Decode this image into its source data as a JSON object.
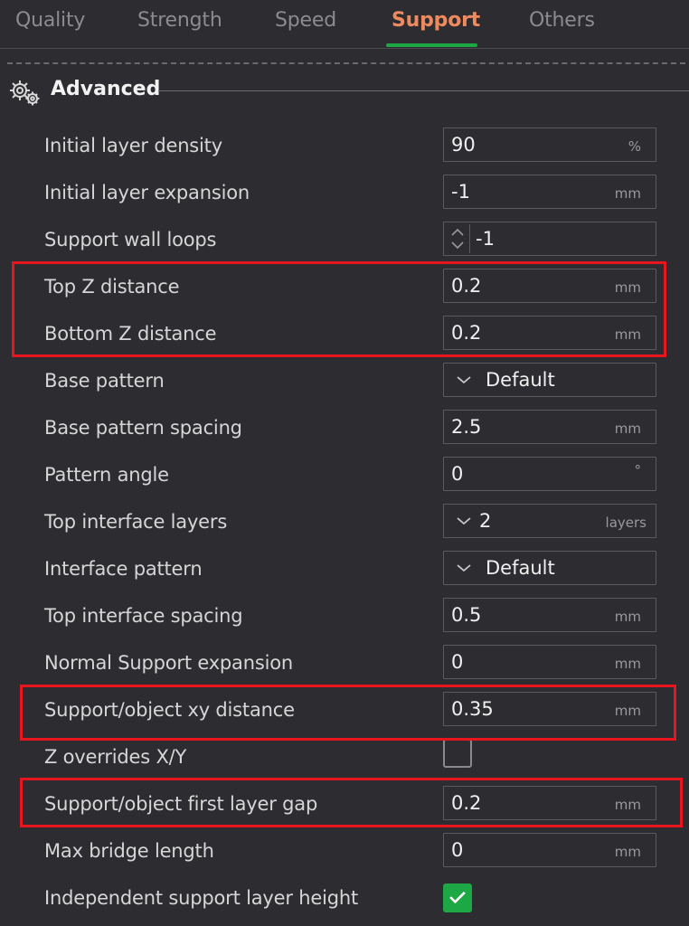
{
  "tabs": [
    {
      "label": "Quality",
      "active": false
    },
    {
      "label": "Strength",
      "active": false
    },
    {
      "label": "Speed",
      "active": false
    },
    {
      "label": "Support",
      "active": true
    },
    {
      "label": "Others",
      "active": false
    }
  ],
  "section": {
    "title": "Advanced",
    "icon": "gears-icon"
  },
  "rows": [
    {
      "label": "Initial layer density",
      "type": "text",
      "value": "90",
      "unit": "%"
    },
    {
      "label": "Initial layer expansion",
      "type": "text",
      "value": "-1",
      "unit": "mm"
    },
    {
      "label": "Support wall loops",
      "type": "spin",
      "value": "-1",
      "unit": ""
    },
    {
      "label": "Top Z distance",
      "type": "text",
      "value": "0.2",
      "unit": "mm"
    },
    {
      "label": "Bottom Z distance",
      "type": "text",
      "value": "0.2",
      "unit": "mm"
    },
    {
      "label": "Base pattern",
      "type": "combo",
      "value": "Default",
      "unit": ""
    },
    {
      "label": "Base pattern spacing",
      "type": "text",
      "value": "2.5",
      "unit": "mm"
    },
    {
      "label": "Pattern angle",
      "type": "text",
      "value": "0",
      "unit": "°"
    },
    {
      "label": "Top interface layers",
      "type": "combo",
      "value": "2",
      "unit": "layers"
    },
    {
      "label": "Interface pattern",
      "type": "combo",
      "value": "Default",
      "unit": ""
    },
    {
      "label": "Top interface spacing",
      "type": "text",
      "value": "0.5",
      "unit": "mm"
    },
    {
      "label": "Normal Support expansion",
      "type": "text",
      "value": "0",
      "unit": "mm"
    },
    {
      "label": "Support/object xy distance",
      "type": "text",
      "value": "0.35",
      "unit": "mm"
    },
    {
      "label": "Z overrides X/Y",
      "type": "checkbox",
      "checked": false
    },
    {
      "label": "Support/object first layer gap",
      "type": "text",
      "value": "0.2",
      "unit": "mm"
    },
    {
      "label": "Max bridge length",
      "type": "text",
      "value": "0",
      "unit": "mm"
    },
    {
      "label": "Independent support layer height",
      "type": "checkbox",
      "checked": true
    }
  ],
  "colors": {
    "background": "#2d2d31",
    "active_tab": "#ef8a5f",
    "tab_underline": "#1ea845",
    "checkbox_checked": "#1ea845",
    "highlight_box": "#e8141e"
  }
}
